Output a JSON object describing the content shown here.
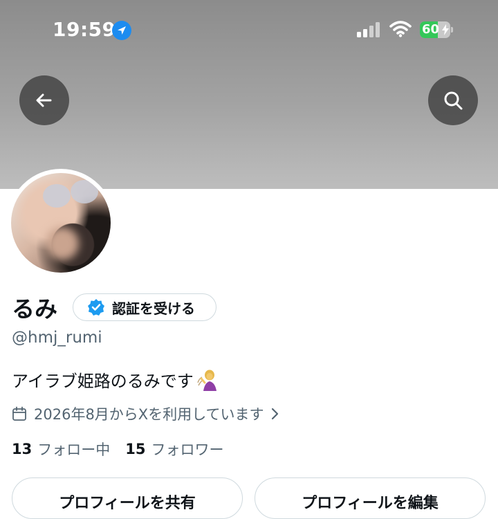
{
  "status_bar": {
    "time": "19:59",
    "battery_level": "60",
    "battery_fraction": 0.6,
    "icons": [
      "location-arrow-icon",
      "cellular-signal-icon",
      "wifi-icon",
      "battery-charging-icon"
    ]
  },
  "header": {
    "back_icon": "arrow-left-icon",
    "search_icon": "search-icon"
  },
  "profile": {
    "display_name": "るみ",
    "verify_label": "認証を受ける",
    "handle": "@hmj_rumi",
    "bio": "アイラブ姫路のるみです",
    "joined": "2026年8月からXを利用しています",
    "following_count": "13",
    "following_label": "フォロー中",
    "followers_count": "15",
    "followers_label": "フォロワー"
  },
  "actions": {
    "share_label": "プロフィールを共有",
    "edit_label": "プロフィールを編集"
  },
  "colors": {
    "accent": "#1d9bf0",
    "text_primary": "#0f1419",
    "text_secondary": "#536471",
    "border": "#cfd9de",
    "battery_green": "#34c759"
  }
}
